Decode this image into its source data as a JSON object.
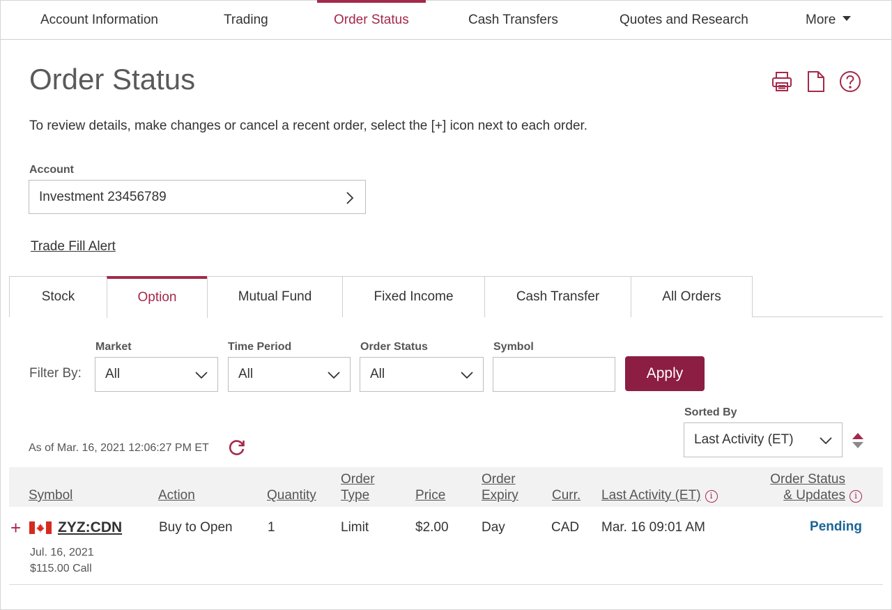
{
  "nav": {
    "items": [
      {
        "label": "Account Information"
      },
      {
        "label": "Trading"
      },
      {
        "label": "Order Status"
      },
      {
        "label": "Cash Transfers"
      },
      {
        "label": "Quotes and Research"
      },
      {
        "label": "More"
      }
    ],
    "active": "Order Status"
  },
  "page": {
    "title": "Order Status",
    "description": "To review details, make changes or cancel a recent order, select the [+] icon next to each order.",
    "icons": [
      "print-icon",
      "document-icon",
      "help-icon"
    ]
  },
  "account": {
    "label": "Account",
    "value": "Investment 23456789"
  },
  "trade_fill_alert": "Trade Fill Alert",
  "tabs": {
    "items": [
      {
        "label": "Stock"
      },
      {
        "label": "Option"
      },
      {
        "label": "Mutual Fund"
      },
      {
        "label": "Fixed Income"
      },
      {
        "label": "Cash Transfer"
      },
      {
        "label": "All Orders"
      }
    ],
    "active": "Option"
  },
  "filters": {
    "filter_by": "Filter By:",
    "market": {
      "label": "Market",
      "value": "All"
    },
    "time_period": {
      "label": "Time Period",
      "value": "All"
    },
    "order_status": {
      "label": "Order Status",
      "value": "All"
    },
    "symbol": {
      "label": "Symbol",
      "value": ""
    },
    "apply": "Apply"
  },
  "sorting": {
    "label": "Sorted By",
    "value": "Last Activity (ET)"
  },
  "as_of": "As of Mar. 16, 2021 12:06:27 PM ET",
  "table": {
    "headers": {
      "symbol": "Symbol",
      "action": "Action",
      "quantity": "Quantity",
      "order_type_1": "Order",
      "order_type_2": "Type",
      "price": "Price",
      "order_expiry_1": "Order",
      "order_expiry_2": "Expiry",
      "curr": "Curr.",
      "last_activity": "Last Activity (ET)",
      "status_1": "Order Status",
      "status_2": "& Updates"
    },
    "rows": [
      {
        "symbol": "ZYZ:CDN",
        "expiry_date": "Jul. 16, 2021",
        "strike": "$115.00 Call",
        "action": "Buy to Open",
        "quantity": "1",
        "order_type": "Limit",
        "price": "$2.00",
        "order_expiry": "Day",
        "currency": "CAD",
        "last_activity": "Mar. 16 09:01 AM",
        "status": "Pending"
      }
    ]
  },
  "colors": {
    "accent": "#a3294a",
    "apply_bg": "#8c1d43",
    "pending": "#1a6496"
  }
}
